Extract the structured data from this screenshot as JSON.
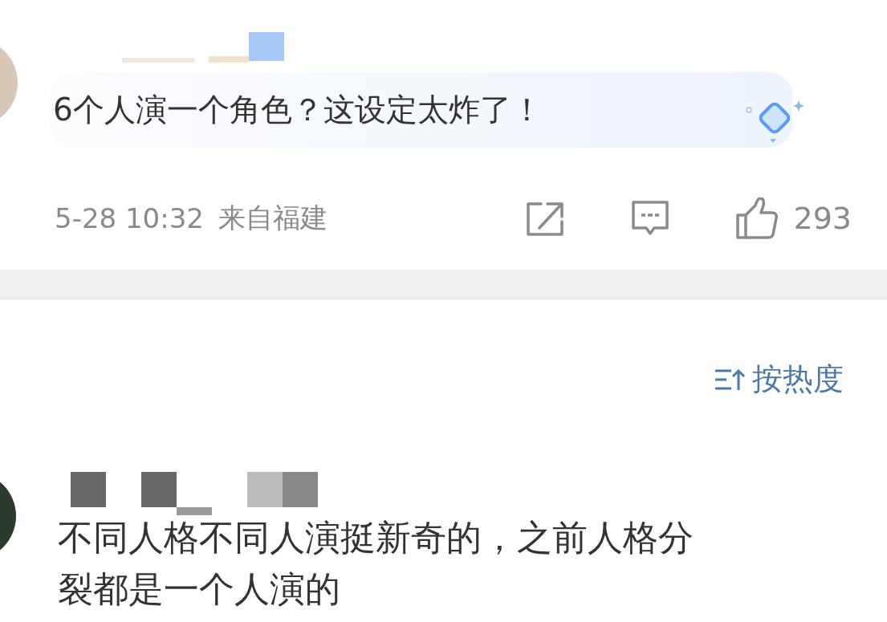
{
  "top_comment": {
    "text": "6个人演一个角色？这设定太炸了！",
    "time": "5-28 10:32",
    "location": "来自福建",
    "like_count": "293"
  },
  "sort": {
    "label": "按热度"
  },
  "reply": {
    "lines": [
      "不同人格不同人演挺新奇的，之前人格分",
      "裂都是一个人演的"
    ]
  }
}
